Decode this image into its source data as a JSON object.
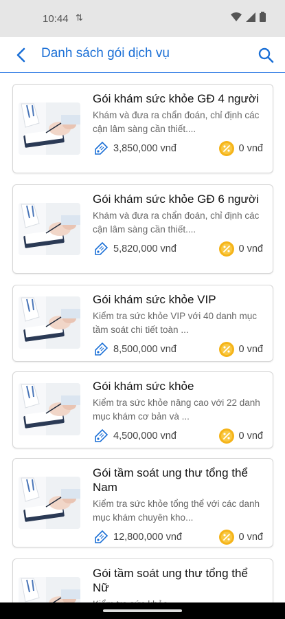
{
  "status": {
    "time": "10:44"
  },
  "header": {
    "title": "Danh sách gói dịch vụ"
  },
  "packages": [
    {
      "name": "Gói khám sức khỏe GĐ 4 người",
      "desc": "Khám và đưa ra chẩn đoán, chỉ định các cận lâm sàng cần thiết....",
      "price": "3,850,000 vnđ",
      "discount": "0 vnđ"
    },
    {
      "name": "Gói khám sức khỏe GĐ 6 người",
      "desc": "Khám và đưa ra chẩn đoán, chỉ định các cận lâm sàng cần thiết....",
      "price": "5,820,000 vnđ",
      "discount": "0 vnđ"
    },
    {
      "name": "Gói khám sức khỏe VIP",
      "desc": "Kiểm tra sức khỏe VIP với 40 danh mục tầm soát chi tiết toàn ...",
      "price": "8,500,000 vnđ",
      "discount": "0 vnđ"
    },
    {
      "name": "Gói khám sức khỏe",
      "desc": "Kiểm tra sức khỏe nâng cao với 22 danh mục khám cơ bản và ...",
      "price": "4,500,000 vnđ",
      "discount": "0 vnđ"
    },
    {
      "name": "Gói tầm soát ung thư tổng thể Nam",
      "desc": "Kiểm tra sức khỏe tổng thể với các danh mục khám chuyên kho...",
      "price": "12,800,000 vnđ",
      "discount": "0 vnđ"
    },
    {
      "name": "Gói tầm soát ung thư tổng thể Nữ",
      "desc": "Kiểm tra sức khỏe",
      "price": "",
      "discount": ""
    }
  ],
  "colors": {
    "accent": "#1a6fd6",
    "coin": "#f5b41a"
  },
  "icons": {
    "back": "chevron-left-icon",
    "search": "search-icon",
    "tag": "price-tag-icon",
    "coin": "discount-coin-icon"
  }
}
